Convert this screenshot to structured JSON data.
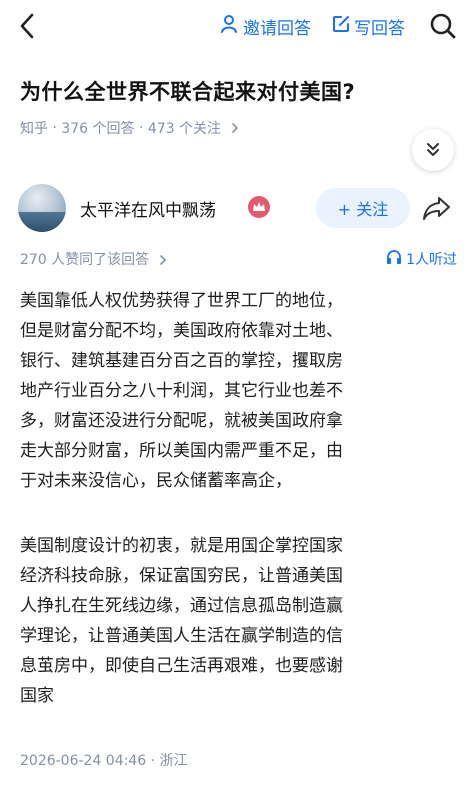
{
  "header": {
    "invite_label": "邀请回答",
    "write_label": "写回答"
  },
  "question": {
    "title": "为什么全世界不联合起来对付美国?",
    "source": "知乎",
    "answers": "376 个回答",
    "followers": "473 个关注"
  },
  "author": {
    "name": "太平洋在风中飘荡",
    "follow_label": "+ 关注"
  },
  "answer": {
    "votes": "270 人赞同了该回答",
    "listen_label": "1人听过",
    "paragraph1": [
      "美国靠低人权优势获得了世界工厂的地位，",
      "但是财富分配不均，美国政府依靠对土地、",
      "银行、建筑基建百分百之百的掌控，攫取房",
      "地产行业百分之八十利润，其它行业也差不",
      "多，财富还没进行分配呢，就被美国政府拿",
      "走大部分财富，所以美国内需严重不足，由",
      "于对未来没信心，民众储蓄率高企，"
    ],
    "paragraph2": [
      "美国制度设计的初衷，就是用国企掌控国家",
      "经济科技命脉，保证富国穷民，让普通美国",
      "人挣扎在生死线边缘，通过信息孤岛制造赢",
      "学理论，让普通美国人生活在赢学制造的信",
      "息茧房中，即使自己生活再艰难，也要感谢",
      "国家"
    ],
    "timestamp": "2026-06-24 04:46 · 浙江"
  },
  "colors": {
    "accent": "#1772f6",
    "meta": "#8590a6",
    "badge": "#e35a6e",
    "follow_bg": "#eaf2ff"
  },
  "icons": [
    "back-arrow-icon",
    "invite-person-icon",
    "edit-icon",
    "search-icon",
    "chevron-double-down-icon",
    "avatar-image",
    "vip-badge-icon",
    "share-icon",
    "headphones-icon"
  ]
}
